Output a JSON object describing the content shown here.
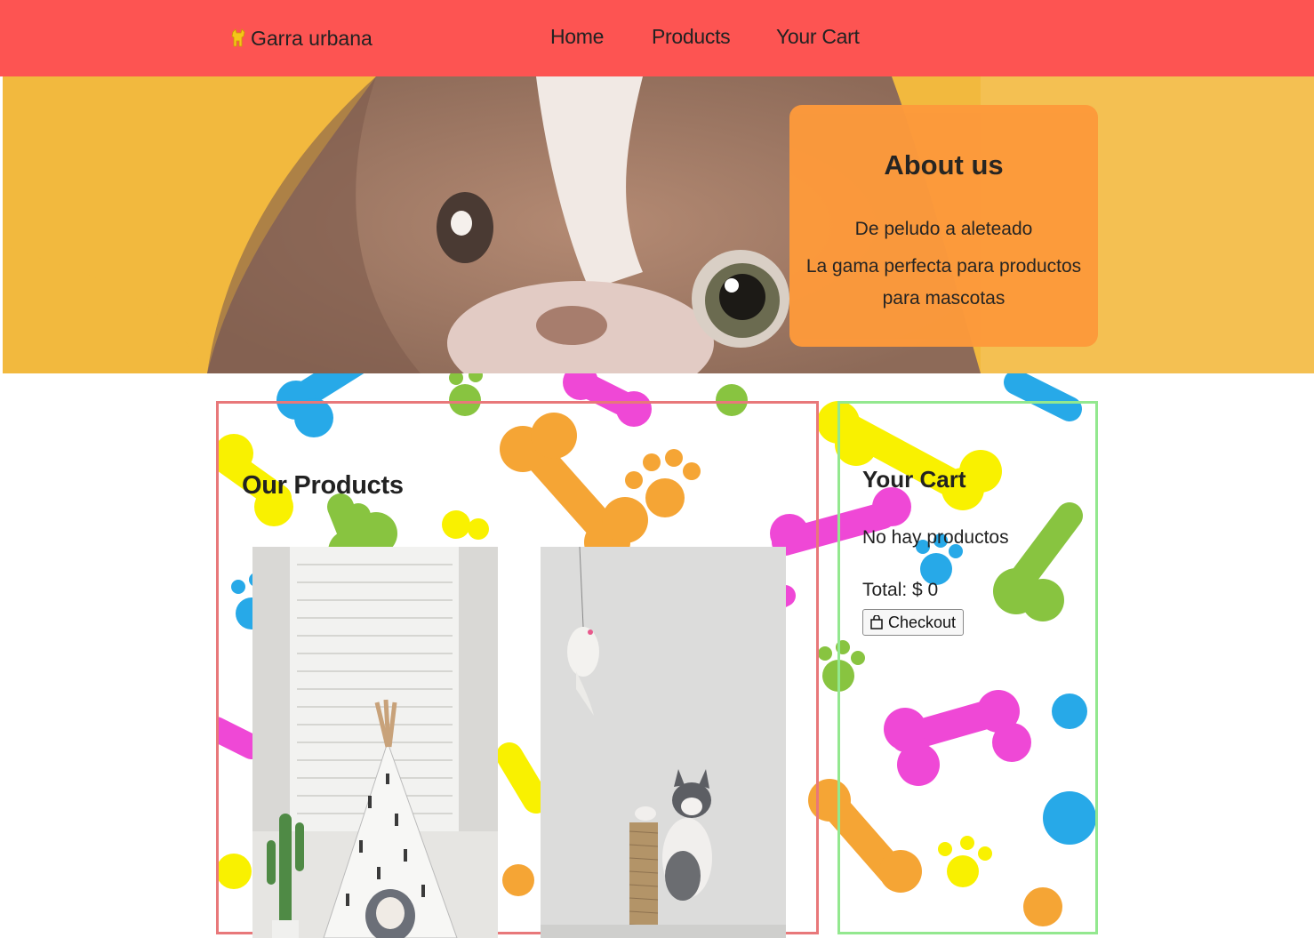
{
  "nav": {
    "brand": "Garra urbana",
    "brand_icon": "dog-icon",
    "links": [
      "Home",
      "Products",
      "Your Cart"
    ]
  },
  "hero": {
    "about_title": "About us",
    "about_subtitle": "De peludo a aleteado",
    "about_description": "La gama perfecta para productos para mascotas"
  },
  "products": {
    "title": "Our Products",
    "items": [
      {
        "image": "dog-teepee-photo"
      },
      {
        "image": "kitten-toy-photo"
      }
    ]
  },
  "cart": {
    "title": "Your Cart",
    "empty_text": "No hay productos",
    "total_text": "Total: $ 0",
    "checkout_label": "Checkout",
    "checkout_icon": "bag-icon"
  },
  "colors": {
    "navbar": "#fd5452",
    "about_card": "#fd9a3b",
    "products_border": "#e8787a",
    "cart_border": "#93e88f"
  }
}
